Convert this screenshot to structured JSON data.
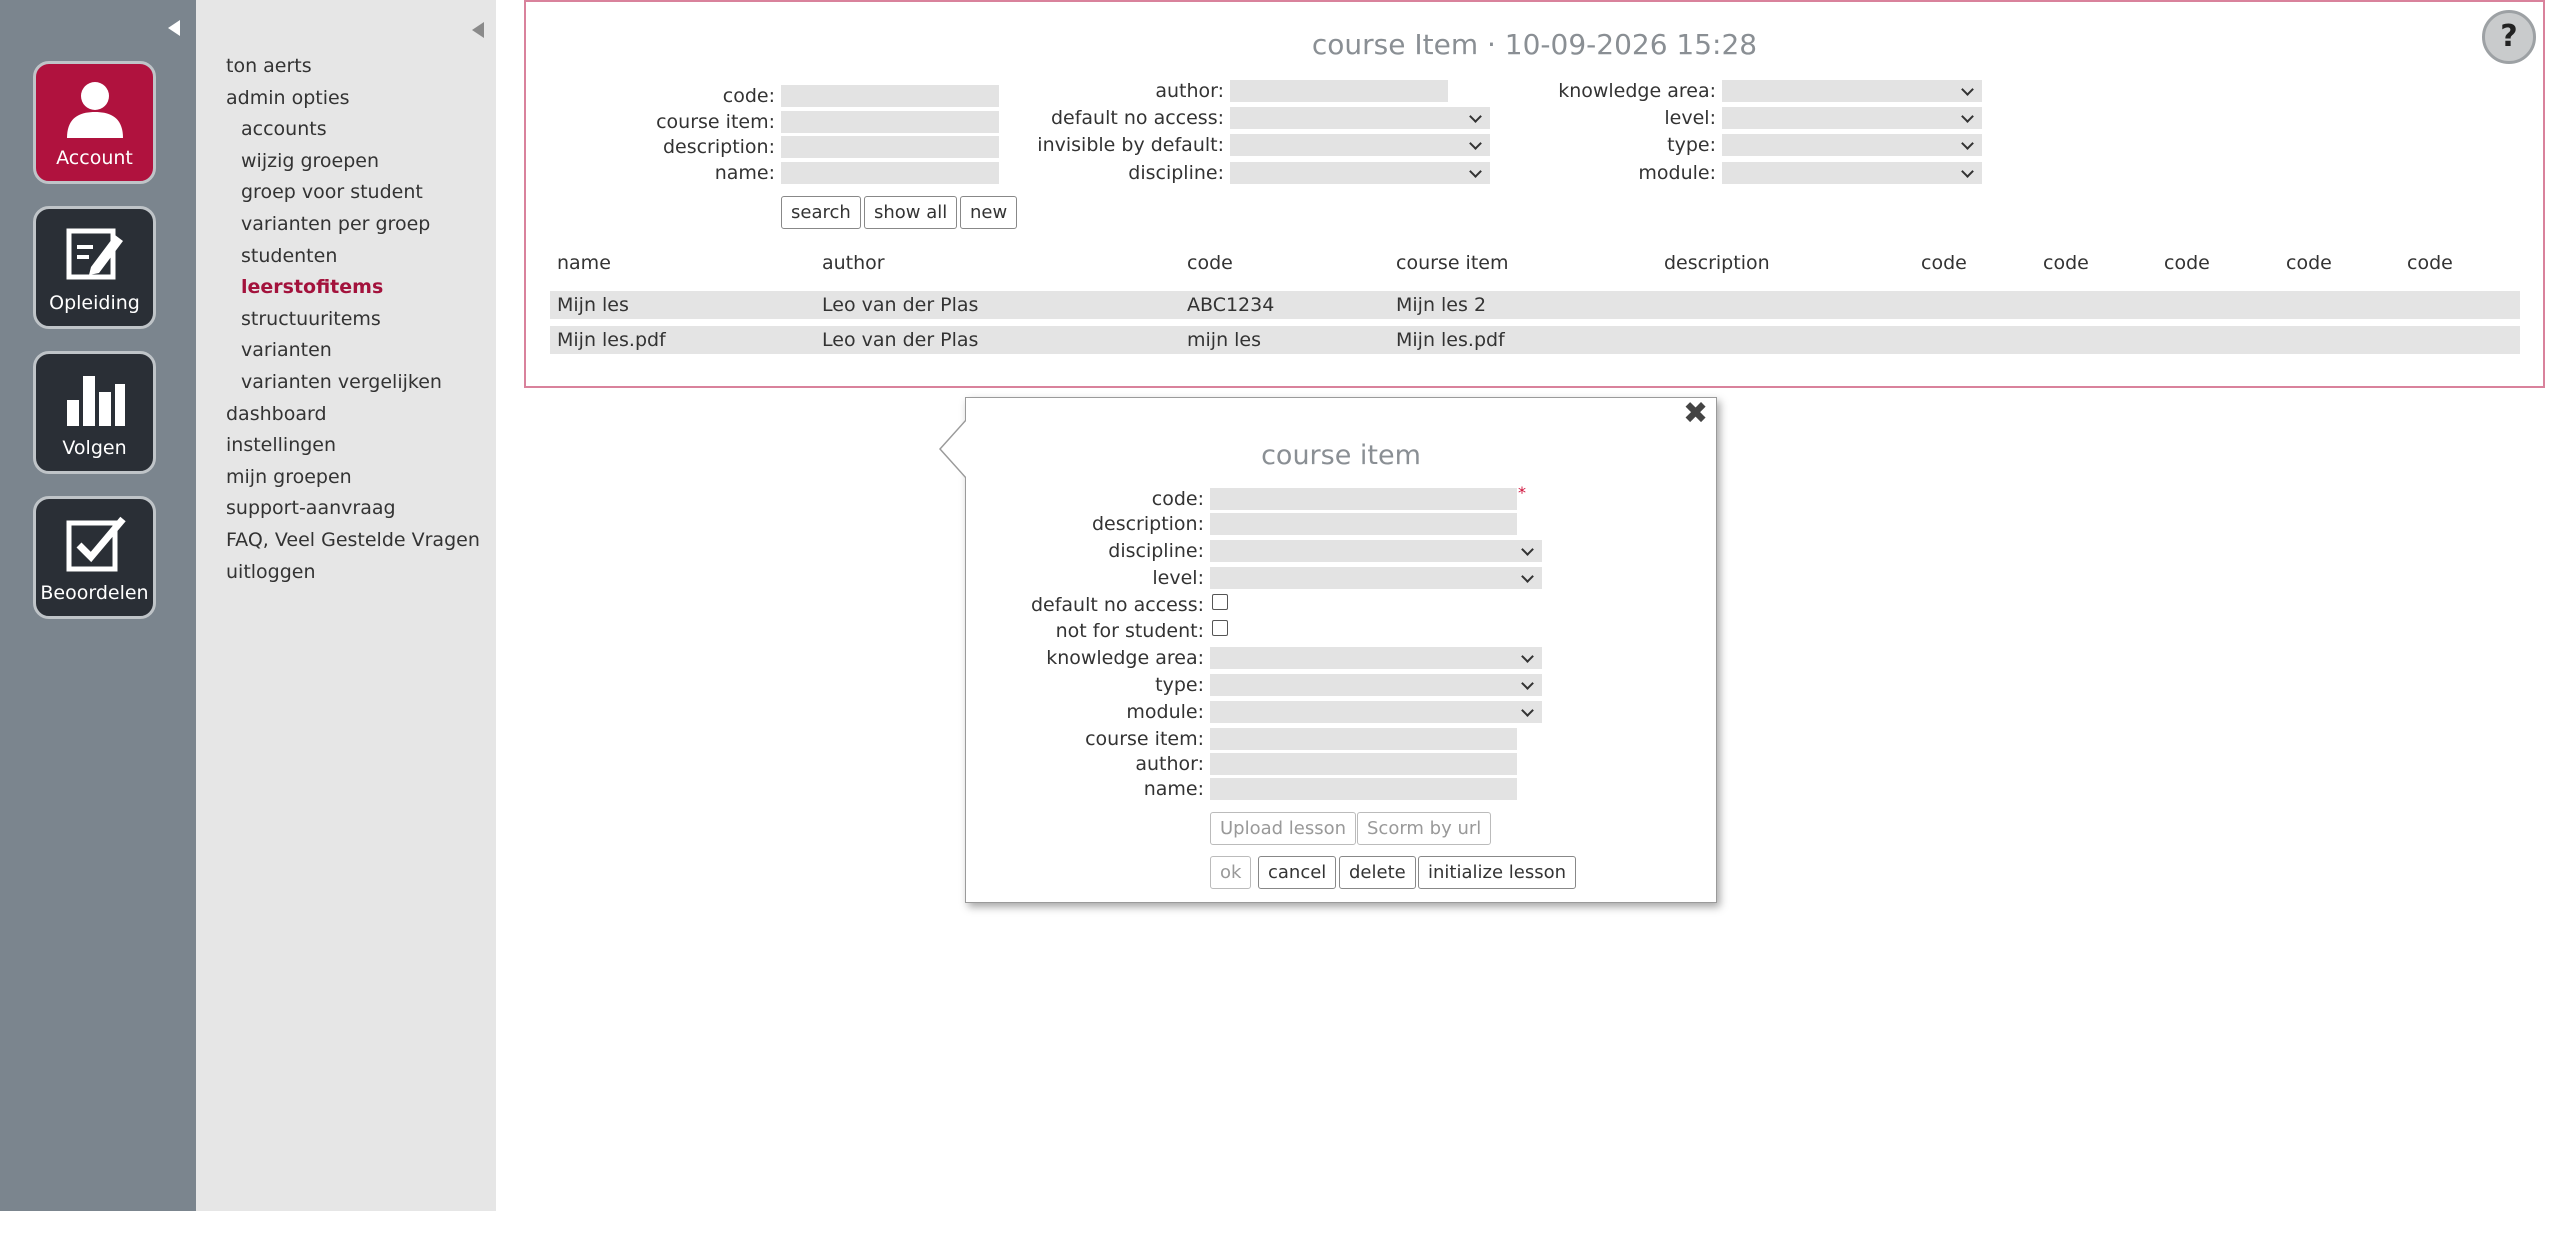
{
  "sidebar": {
    "tiles": [
      {
        "label": "Account",
        "icon": "person-icon"
      },
      {
        "label": "Opleiding",
        "icon": "edit-note-icon"
      },
      {
        "label": "Volgen",
        "icon": "bar-chart-icon"
      },
      {
        "label": "Beoordelen",
        "icon": "checkbox-icon"
      }
    ]
  },
  "nav": {
    "items": [
      "ton aerts",
      "admin opties",
      "accounts",
      "wijzig groepen",
      "groep voor student",
      "varianten per groep",
      "studenten",
      "leerstofitems",
      "structuuritems",
      "varianten",
      "varianten vergelijken",
      "dashboard",
      "instellingen",
      "mijn groepen",
      "support-aanvraag",
      "FAQ, Veel Gestelde Vragen",
      "uitloggen"
    ]
  },
  "search": {
    "title": "course Item · 10-09-2026 15:28",
    "labels": {
      "code": "code:",
      "course_item": "course item:",
      "description": "description:",
      "name": "name:",
      "author": "author:",
      "default_no_access": "default no access:",
      "invisible_by_default": "invisible by default:",
      "discipline": "discipline:",
      "knowledge_area": "knowledge area:",
      "level": "level:",
      "type": "type:",
      "module": "module:"
    },
    "buttons": {
      "search": "search",
      "show_all": "show all",
      "new": "new"
    }
  },
  "table": {
    "headers": [
      "name",
      "author",
      "code",
      "course item",
      "description",
      "code",
      "code",
      "code",
      "code",
      "code"
    ],
    "rows": [
      [
        "Mijn les",
        "Leo van der Plas",
        "ABC1234",
        "Mijn les 2"
      ],
      [
        "Mijn les.pdf",
        "Leo van der Plas",
        "mijn les",
        "Mijn les.pdf"
      ]
    ]
  },
  "dialog": {
    "title": "course item",
    "required_mark": "*",
    "labels": {
      "code": "code:",
      "description": "description:",
      "discipline": "discipline:",
      "level": "level:",
      "default_no_access": "default no access:",
      "not_for_student": "not for student:",
      "knowledge_area": "knowledge area:",
      "type": "type:",
      "module": "module:",
      "course_item": "course item:",
      "author": "author:",
      "name": "name:"
    },
    "buttons": {
      "upload": "Upload lesson",
      "scorm": "Scorm by url",
      "ok": "ok",
      "cancel": "cancel",
      "delete": "delete",
      "initialize": "initialize lesson"
    },
    "default_no_access_checked": false,
    "not_for_student_checked": false
  },
  "colors": {
    "accent": "#b0123e",
    "sidebar": "#7b858e",
    "panel": "#e6e6e6",
    "border": "#d9829c"
  }
}
